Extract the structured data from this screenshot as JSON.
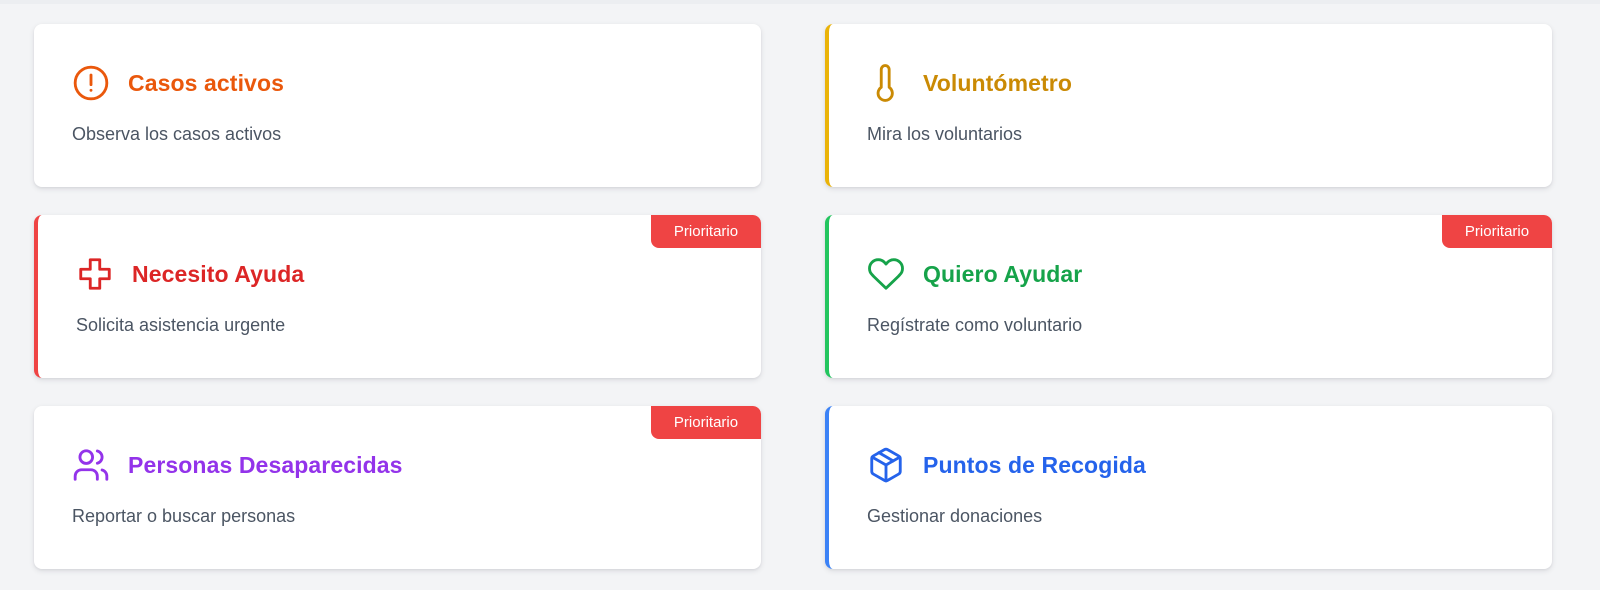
{
  "cards": [
    {
      "title": "Casos activos",
      "description": "Observa los casos activos",
      "icon": "alert-circle-icon",
      "color": "#ea580c",
      "accent": null,
      "badge": null
    },
    {
      "title": "Voluntómetro",
      "description": "Mira los voluntarios",
      "icon": "thermometer-icon",
      "color": "#ca8a04",
      "accent": "#eab308",
      "badge": null
    },
    {
      "title": "Necesito Ayuda",
      "description": "Solicita asistencia urgente",
      "icon": "medical-cross-icon",
      "color": "#dc2626",
      "accent": "#ef4444",
      "badge": "Prioritario"
    },
    {
      "title": "Quiero Ayudar",
      "description": "Regístrate como voluntario",
      "icon": "heart-icon",
      "color": "#16a34a",
      "accent": "#22c55e",
      "badge": "Prioritario"
    },
    {
      "title": "Personas Desaparecidas",
      "description": "Reportar o buscar personas",
      "icon": "users-icon",
      "color": "#9333ea",
      "accent": null,
      "badge": "Prioritario"
    },
    {
      "title": "Puntos de Recogida",
      "description": "Gestionar donaciones",
      "icon": "package-icon",
      "color": "#2563eb",
      "accent": "#3b82f6",
      "badge": null
    }
  ]
}
